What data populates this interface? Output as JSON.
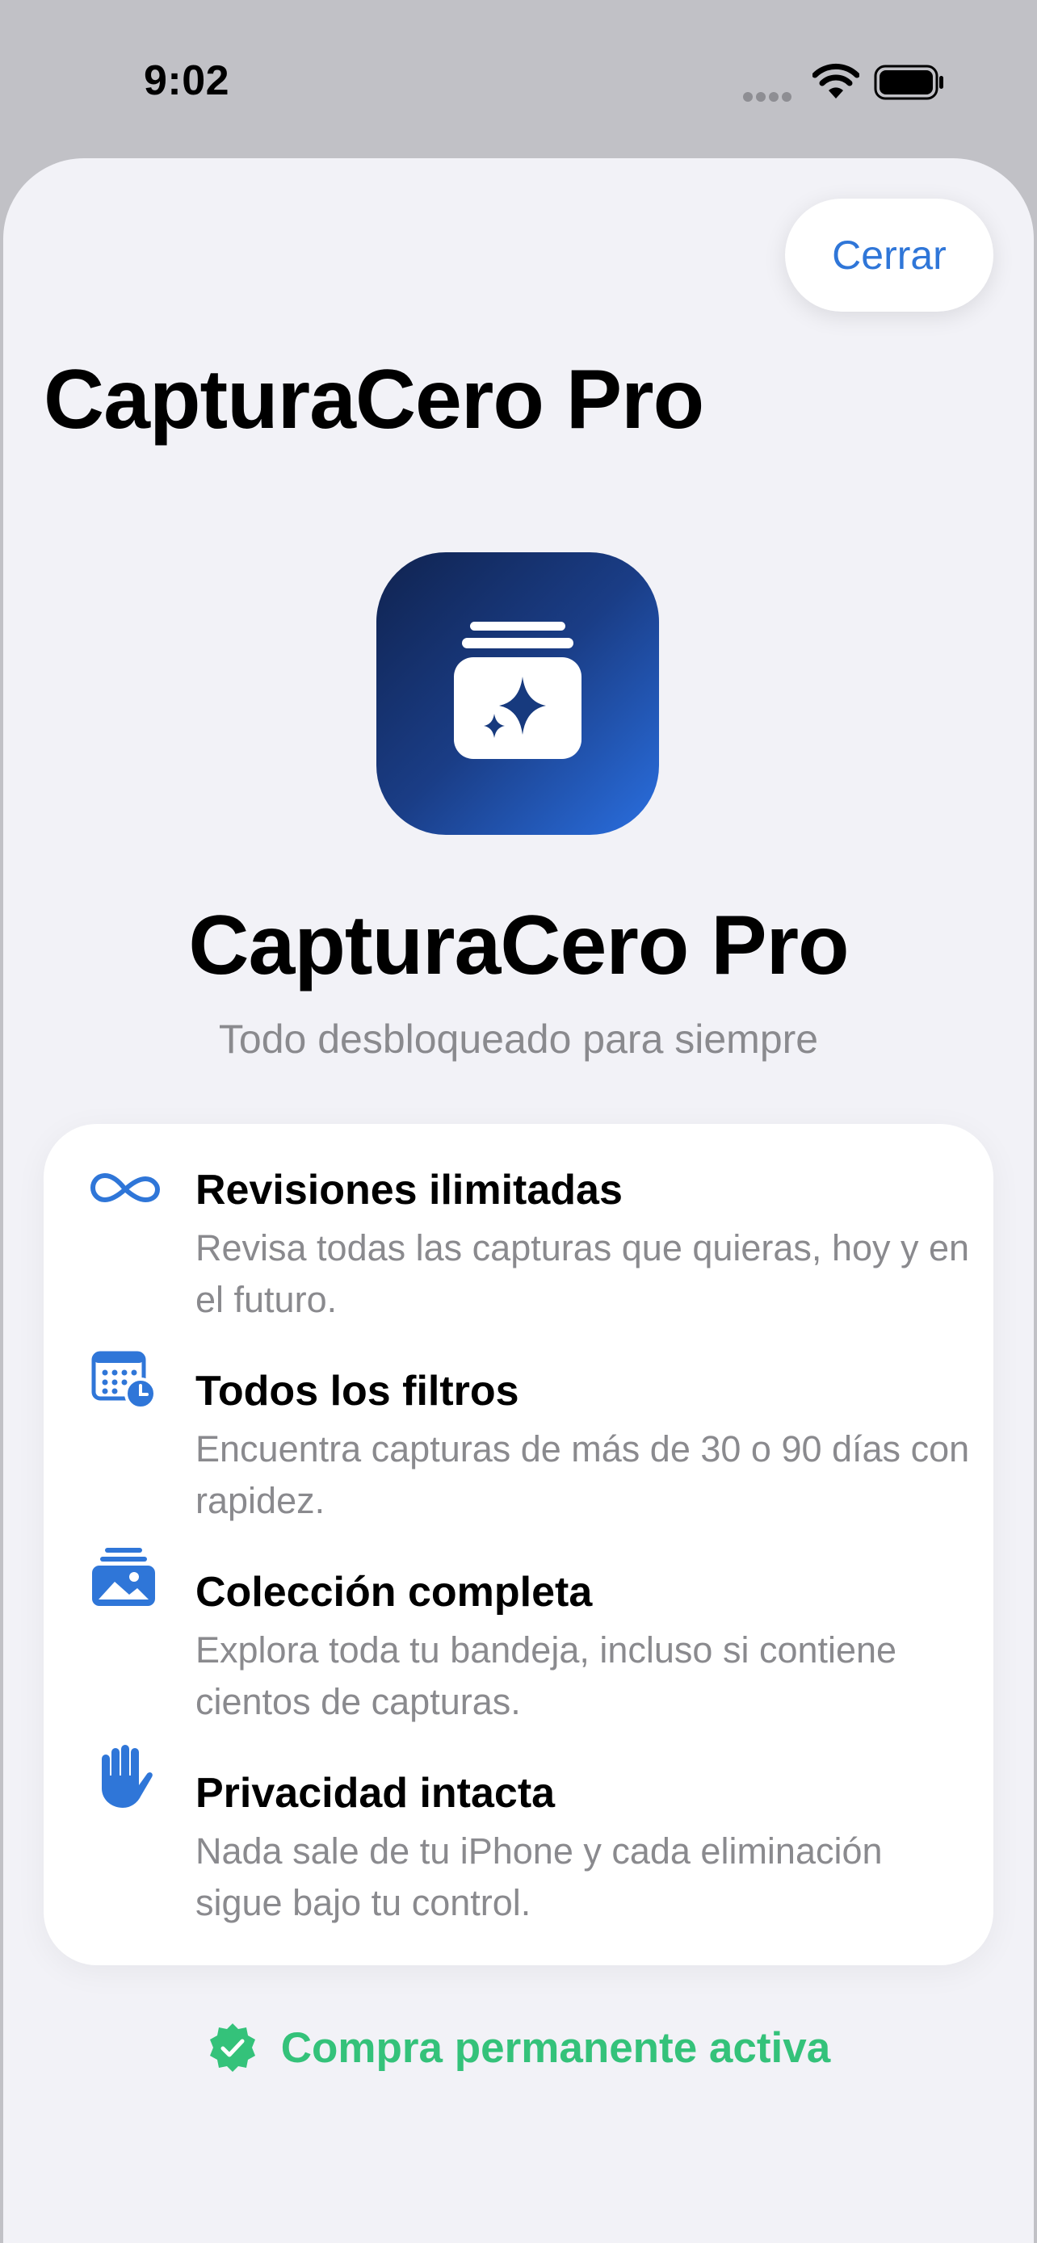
{
  "status_bar": {
    "time": "9:02"
  },
  "header": {
    "close_label": "Cerrar",
    "nav_title": "CapturaCero Pro"
  },
  "hero": {
    "title": "CapturaCero Pro",
    "subtitle": "Todo desbloqueado para siempre"
  },
  "features": [
    {
      "icon": "infinity-icon",
      "title": "Revisiones ilimitadas",
      "description": "Revisa todas las capturas que quieras, hoy y en el futuro."
    },
    {
      "icon": "calendar-clock-icon",
      "title": "Todos los filtros",
      "description": "Encuentra capturas de más de 30 o 90 días con rapidez."
    },
    {
      "icon": "photo-stack-icon",
      "title": "Colección completa",
      "description": "Explora toda tu bandeja, incluso si contiene cientos de capturas."
    },
    {
      "icon": "hand-raised-icon",
      "title": "Privacidad intacta",
      "description": "Nada sale de tu iPhone y cada eliminación sigue bajo tu control."
    }
  ],
  "purchase": {
    "status_label": "Compra permanente activa",
    "icon": "checkmark-seal-icon"
  },
  "colors": {
    "accent": "#2f76d8",
    "success": "#34c27a",
    "sheet_background": "#f2f2f7",
    "icon_gradient_start": "#102350",
    "icon_gradient_end": "#2a6fe0"
  }
}
